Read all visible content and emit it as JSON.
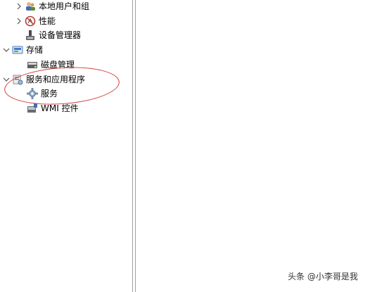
{
  "tree": {
    "items": [
      {
        "label": "本地用户和组",
        "icon": "users-icon",
        "expander": "collapsed"
      },
      {
        "label": "性能",
        "icon": "performance-icon",
        "expander": "collapsed"
      },
      {
        "label": "设备管理器",
        "icon": "device-manager-icon",
        "expander": "none"
      },
      {
        "label": "存储",
        "icon": "storage-icon",
        "expander": "expanded"
      },
      {
        "label": "磁盘管理",
        "icon": "disk-management-icon",
        "expander": "none"
      },
      {
        "label": "服务和应用程序",
        "icon": "services-apps-icon",
        "expander": "expanded"
      },
      {
        "label": "服务",
        "icon": "gear-icon",
        "expander": "none"
      },
      {
        "label": "WMI 控件",
        "icon": "wmi-control-icon",
        "expander": "none"
      }
    ]
  },
  "annotation": {
    "color": "#d23a3a"
  },
  "watermark": "头条 @小李哥是我"
}
